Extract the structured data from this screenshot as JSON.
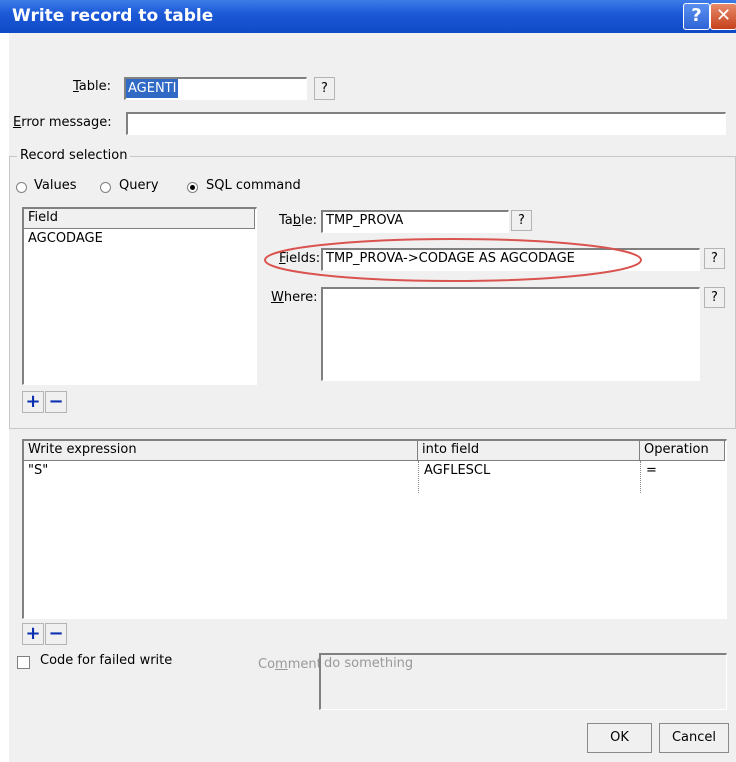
{
  "window": {
    "title": "Write record to table"
  },
  "top": {
    "table_label": "Table:",
    "table_value": "AGENTI",
    "table_help": "?",
    "error_label": "Error message:",
    "error_value": ""
  },
  "record_selection": {
    "title": "Record selection",
    "options": [
      {
        "label": "Values",
        "selected": false
      },
      {
        "label": "Query",
        "selected": false
      },
      {
        "label": "SQL command",
        "selected": true
      }
    ],
    "field_list": {
      "header": "Field",
      "items": [
        "AGCODAGE"
      ]
    },
    "sql": {
      "table_label": "Table:",
      "table_value": "TMP_PROVA",
      "fields_label": "Fields:",
      "fields_value": "TMP_PROVA->CODAGE AS AGCODAGE",
      "where_label": "Where:",
      "where_value": "",
      "help": "?"
    },
    "add_label": "+",
    "remove_label": "−"
  },
  "write_table": {
    "headers": [
      "Write expression",
      "into field",
      "Operation"
    ],
    "rows": [
      {
        "expression": "\"S\"",
        "into_field": "AGFLESCL",
        "operation": "="
      }
    ],
    "add_label": "+",
    "remove_label": "−"
  },
  "bottom": {
    "code_failed_label": "Code for failed write",
    "code_failed_checked": false,
    "comment_label": "Comment:",
    "comment_value": "do something"
  },
  "buttons": {
    "ok": "OK",
    "cancel": "Cancel"
  },
  "colors": {
    "title_bar": "#1c5ad8",
    "highlight": "#316ac5",
    "annotation_ellipse": "#d9534f",
    "plus_minus": "#0a2fb0"
  }
}
